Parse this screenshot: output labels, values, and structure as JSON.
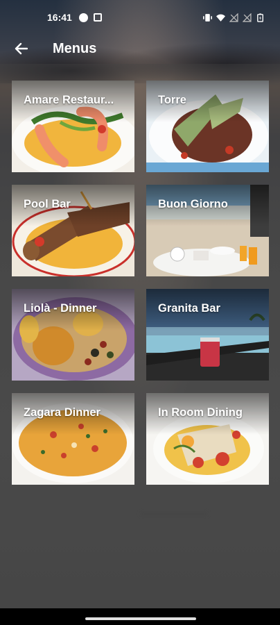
{
  "status": {
    "time": "16:41"
  },
  "appbar": {
    "title": "Menus",
    "back_icon": "arrow-back-icon"
  },
  "menus": [
    {
      "label": "Amare Restaur...",
      "art": "shrimp"
    },
    {
      "label": "Torre",
      "art": "steak"
    },
    {
      "label": "Pool Bar",
      "art": "cannoli"
    },
    {
      "label": "Buon Giorno",
      "art": "terrace"
    },
    {
      "label": "Liolà - Dinner",
      "art": "potatoes"
    },
    {
      "label": "Granita Bar",
      "art": "poolbar"
    },
    {
      "label": "Zagara Dinner",
      "art": "risotto"
    },
    {
      "label": "In Room Dining",
      "art": "plate"
    }
  ]
}
